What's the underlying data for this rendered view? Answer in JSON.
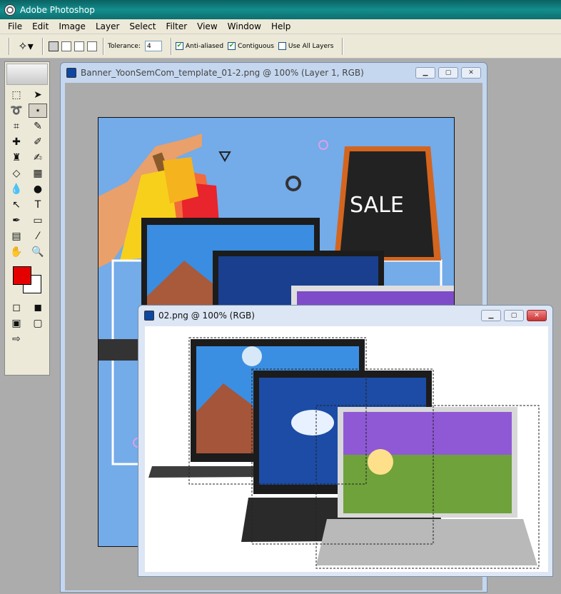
{
  "app": {
    "title": "Adobe Photoshop"
  },
  "menu": [
    "File",
    "Edit",
    "Image",
    "Layer",
    "Select",
    "Filter",
    "View",
    "Window",
    "Help"
  ],
  "options": {
    "tolerance_label": "Tolerance:",
    "tolerance_value": "4",
    "anti_aliased_label": "Anti-aliased",
    "anti_aliased_checked": true,
    "contiguous_label": "Contiguous",
    "contiguous_checked": true,
    "use_all_layers_label": "Use All Layers",
    "use_all_layers_checked": false
  },
  "toolbox": {
    "foreground_color": "#e50000",
    "background_color": "#ffffff",
    "active_tool": "magic-wand"
  },
  "doc1": {
    "title": "Banner_YoonSemCom_template_01-2.png @ 100% (Layer 1, RGB)",
    "sign_text": "SALE"
  },
  "doc2": {
    "title": "02.png @ 100% (RGB)"
  },
  "colors": {
    "banner_bg": "#74abe9",
    "title_bar": "#148d8d"
  }
}
